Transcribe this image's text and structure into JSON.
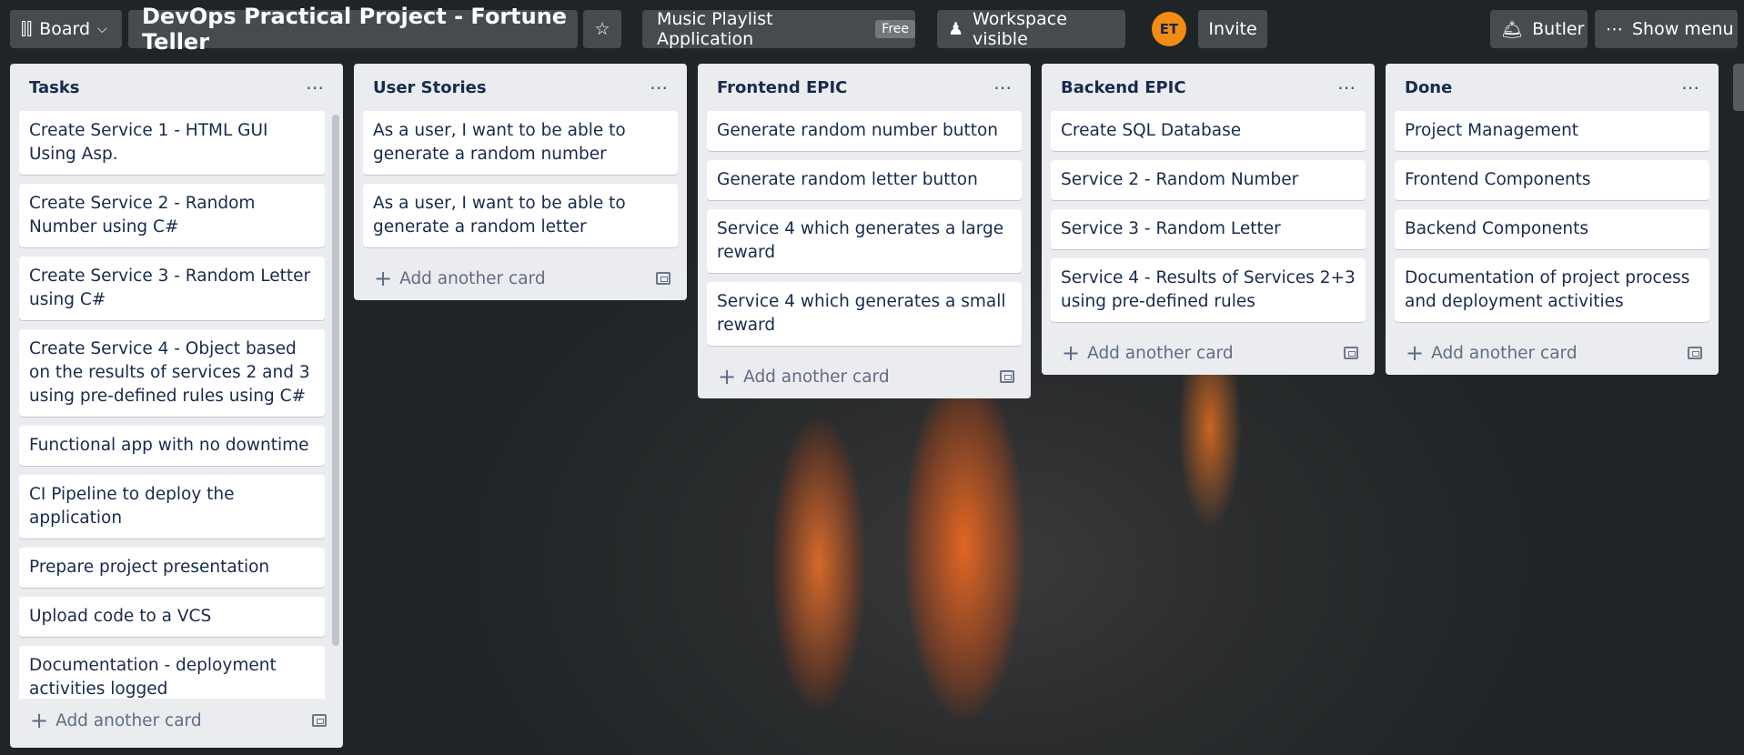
{
  "header": {
    "board_selector": "Board",
    "board_title": "DevOps Practical Project - Fortune Teller",
    "workspace": "Music Playlist Application",
    "workspace_badge": "Free",
    "visibility": "Workspace visible",
    "avatar_initials": "ET",
    "invite": "Invite",
    "butler": "Butler",
    "show_menu": "Show menu"
  },
  "lists": [
    {
      "title": "Tasks",
      "cards": [
        "Create Service 1 - HTML GUI Using Asp.",
        "Create Service 2 - Random Number using C#",
        "Create Service 3 - Random Letter using C#",
        "Create Service 4 - Object based on the results of services 2 and 3 using pre-defined rules using C#",
        "Functional app with no downtime",
        "CI Pipeline to deploy the application",
        "Prepare project presentation",
        "Upload code to a VCS",
        "Documentation - deployment activities logged"
      ],
      "add_label": "Add another card"
    },
    {
      "title": "User Stories",
      "cards": [
        "As a user, I want to be able to generate a random number",
        "As a user, I want to be able to generate a random letter"
      ],
      "add_label": "Add another card"
    },
    {
      "title": "Frontend EPIC",
      "cards": [
        "Generate random number button",
        "Generate random letter button",
        "Service 4 which generates a large reward",
        "Service 4 which generates a small reward"
      ],
      "add_label": "Add another card"
    },
    {
      "title": "Backend EPIC",
      "cards": [
        "Create SQL Database",
        "Service 2 - Random Number",
        "Service 3 - Random Letter",
        "Service 4 - Results of Services 2+3 using pre-defined rules"
      ],
      "add_label": "Add another card"
    },
    {
      "title": "Done",
      "cards": [
        "Project Management",
        "Frontend Components",
        "Backend Components",
        "Documentation of project process and deployment activities"
      ],
      "add_label": "Add another card"
    }
  ],
  "colors": {
    "avatar": "#f28c12",
    "list_bg": "#ebecf0"
  }
}
